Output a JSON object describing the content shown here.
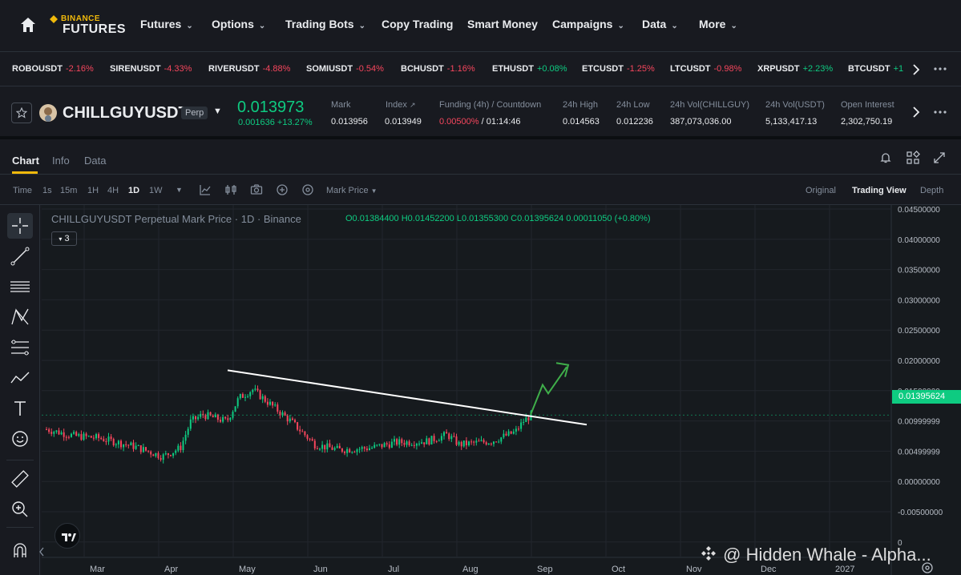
{
  "brand": {
    "top": "BINANCE",
    "bottom": "FUTURES"
  },
  "nav": [
    {
      "label": "Futures",
      "dropdown": true
    },
    {
      "label": "Options",
      "dropdown": true
    },
    {
      "label": "Trading Bots",
      "dropdown": true
    },
    {
      "label": "Copy Trading",
      "dropdown": false
    },
    {
      "label": "Smart Money",
      "dropdown": false
    },
    {
      "label": "Campaigns",
      "dropdown": true
    },
    {
      "label": "Data",
      "dropdown": true
    },
    {
      "label": "More",
      "dropdown": true
    }
  ],
  "ticker": [
    {
      "symbol": "ROBOUSDT",
      "change": "-2.16%",
      "dir": "neg"
    },
    {
      "symbol": "SIRENUSDT",
      "change": "-4.33%",
      "dir": "neg"
    },
    {
      "symbol": "RIVERUSDT",
      "change": "-4.88%",
      "dir": "neg"
    },
    {
      "symbol": "SOMIUSDT",
      "change": "-0.54%",
      "dir": "neg"
    },
    {
      "symbol": "BCHUSDT",
      "change": "-1.16%",
      "dir": "neg"
    },
    {
      "symbol": "ETHUSDT",
      "change": "+0.08%",
      "dir": "pos"
    },
    {
      "symbol": "ETCUSDT",
      "change": "-1.25%",
      "dir": "neg"
    },
    {
      "symbol": "LTCUSDT",
      "change": "-0.98%",
      "dir": "neg"
    },
    {
      "symbol": "XRPUSDT",
      "change": "+2.23%",
      "dir": "pos"
    },
    {
      "symbol": "BTCUSDT",
      "change": "+1",
      "dir": "pos"
    }
  ],
  "symbol": {
    "name": "CHILLGUYUSDT",
    "badge": "Perp",
    "last_price": "0.013973",
    "change": "0.001636 +13.27%"
  },
  "stats": [
    {
      "label": "Mark",
      "value": "0.013956"
    },
    {
      "label": "Index",
      "value": "0.013949"
    },
    {
      "label": "Funding (4h) / Countdown",
      "value_rate": "0.00500%",
      "value_countdown": " / 01:14:46"
    },
    {
      "label": "24h High",
      "value": "0.014563"
    },
    {
      "label": "24h Low",
      "value": "0.012236"
    },
    {
      "label": "24h Vol(CHILLGUY)",
      "value": "387,073,036.00"
    },
    {
      "label": "24h Vol(USDT)",
      "value": "5,133,417.13"
    },
    {
      "label": "Open Interest",
      "value": "2,302,750.19"
    }
  ],
  "chart_tabs": [
    "Chart",
    "Info",
    "Data"
  ],
  "intervals": [
    "Time",
    "1s",
    "15m",
    "1H",
    "4H",
    "1D",
    "1W"
  ],
  "active_interval": "1D",
  "price_type": "Mark Price",
  "views": [
    "Original",
    "Trading View",
    "Depth"
  ],
  "active_view": "Trading View",
  "legend": {
    "title": "CHILLGUYUSDT Perpetual Mark Price · 1D · Binance",
    "ohlc": "O0.01384400 H0.01452200 L0.01355300 C0.01395624 0.00011050 (+0.80%)",
    "indicator_count": "3"
  },
  "current_price_tag": "0.01395624",
  "watermark": "@ Hidden Whale - Alpha...",
  "colors": {
    "up": "#0ecb81",
    "down": "#f6465d",
    "accent": "#f0b90b",
    "bg": "#181a20"
  },
  "chart_data": {
    "type": "candlestick",
    "price_axis": [
      "0.04500000",
      "0.04000000",
      "0.03500000",
      "0.03000000",
      "0.02500000",
      "0.02000000",
      "0.01500000",
      "0.00999999",
      "0.00499999",
      "0.00000000",
      "-0.00500000",
      "0"
    ],
    "time_axis": [
      "Mar",
      "Apr",
      "May",
      "Jun",
      "Jul",
      "Aug",
      "Sep",
      "Oct",
      "Nov",
      "Dec",
      "2027"
    ],
    "ylim": [
      -0.0075,
      0.045
    ],
    "approx_close_path": [
      {
        "t": "Feb",
        "v": 0.0118
      },
      {
        "t": "Mar",
        "v": 0.0105
      },
      {
        "t": "Apr",
        "v": 0.0075
      },
      {
        "t": "Apr late",
        "v": 0.0145
      },
      {
        "t": "May",
        "v": 0.0125
      },
      {
        "t": "May mid",
        "v": 0.017
      },
      {
        "t": "Jun",
        "v": 0.0095
      },
      {
        "t": "Jul",
        "v": 0.0085
      },
      {
        "t": "Jul mid",
        "v": 0.0105
      },
      {
        "t": "Aug",
        "v": 0.0095
      },
      {
        "t": "Aug end",
        "v": 0.012
      },
      {
        "t": "Sep",
        "v": 0.014
      }
    ],
    "trendline": {
      "from": {
        "t": "Apr",
        "v": 0.0207
      },
      "to": {
        "t": "Sep mid",
        "v": 0.0125
      }
    },
    "projection": "arrow up"
  }
}
